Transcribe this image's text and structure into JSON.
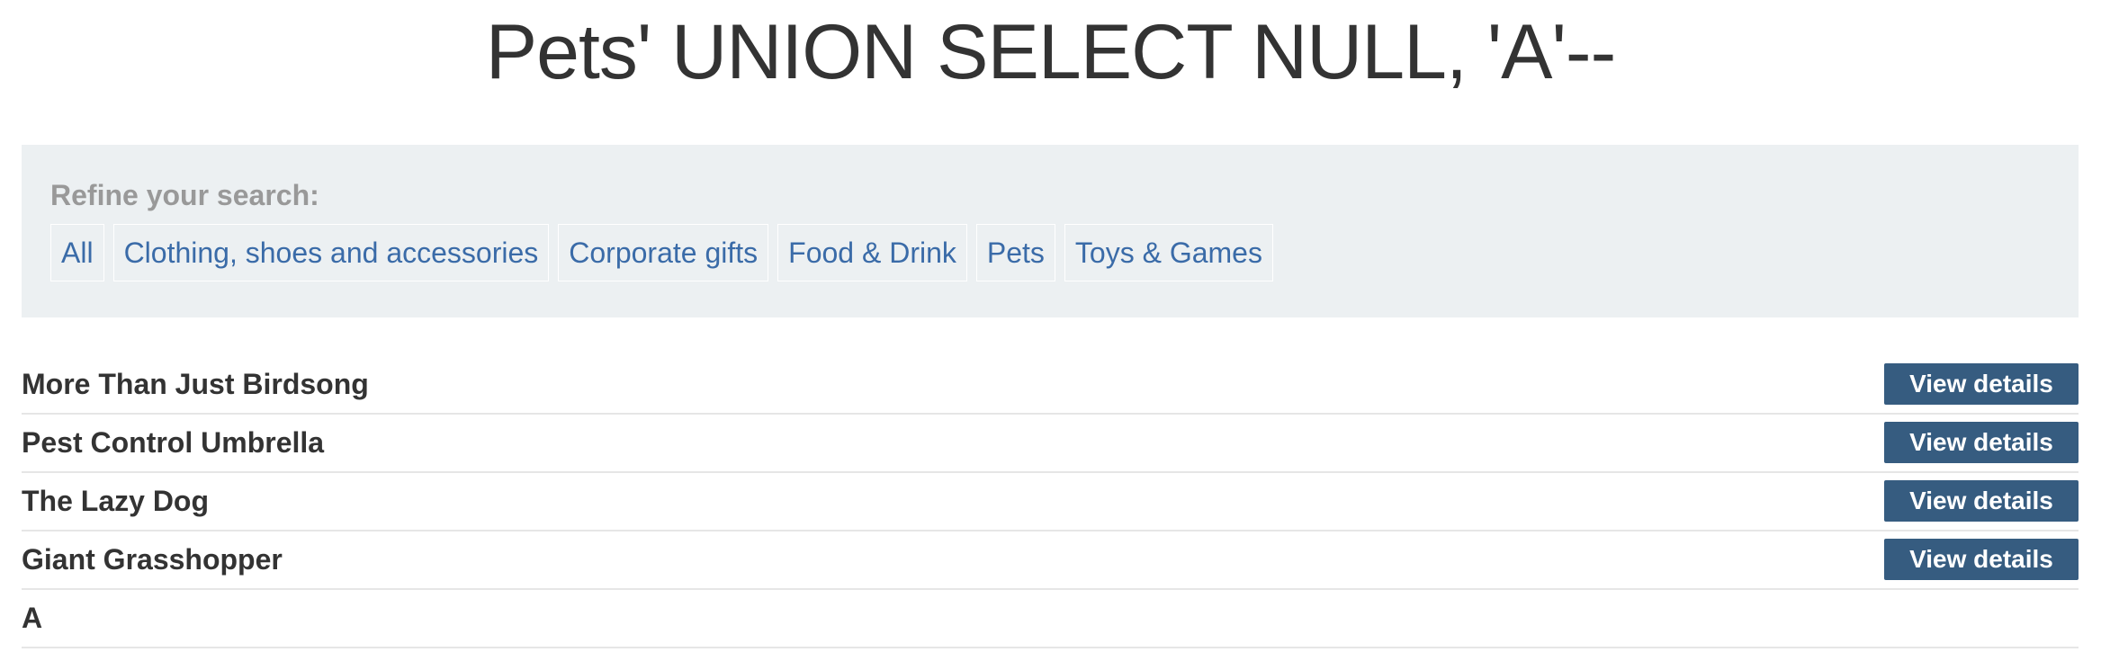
{
  "page": {
    "title": "Pets' UNION SELECT NULL, 'A'--"
  },
  "filter": {
    "heading": "Refine your search:",
    "categories": [
      {
        "label": "All"
      },
      {
        "label": "Clothing, shoes and accessories"
      },
      {
        "label": "Corporate gifts"
      },
      {
        "label": "Food & Drink"
      },
      {
        "label": "Pets"
      },
      {
        "label": "Toys & Games"
      }
    ]
  },
  "results": [
    {
      "name": "More Than Just Birdsong",
      "button_label": "View details"
    },
    {
      "name": "Pest Control Umbrella",
      "button_label": "View details"
    },
    {
      "name": "The Lazy Dog",
      "button_label": "View details"
    },
    {
      "name": "Giant Grasshopper",
      "button_label": "View details"
    },
    {
      "name": "A"
    }
  ],
  "colors": {
    "link": "#3a6ba8",
    "button": "#365c80",
    "panel": "#ecf0f2",
    "heading_muted": "#999999"
  }
}
